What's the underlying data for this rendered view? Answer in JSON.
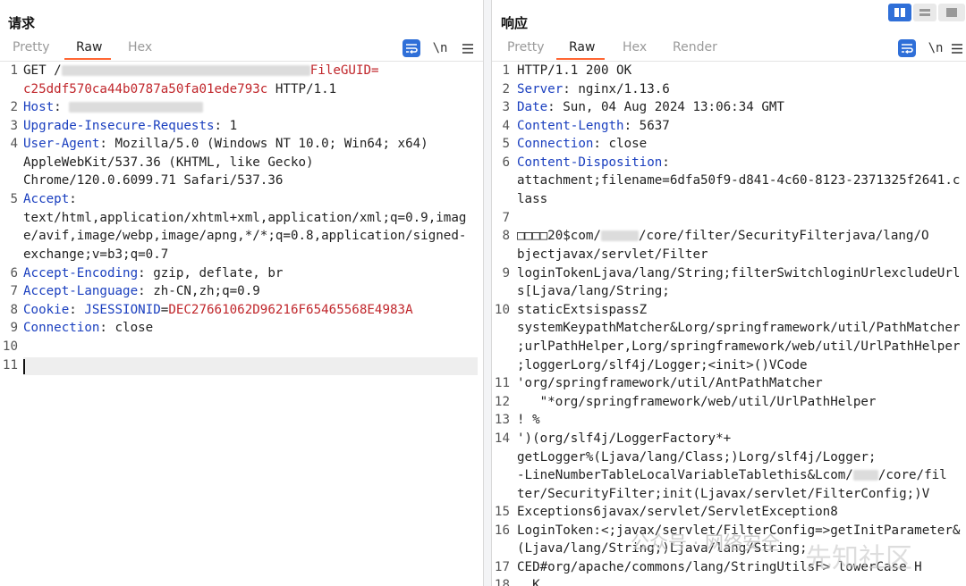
{
  "request": {
    "title": "请求",
    "tabs": [
      "Pretty",
      "Raw",
      "Hex"
    ],
    "active_tab": "Raw",
    "wrap_icon": "wrap-lines-icon",
    "newline_toggle": "\\n",
    "menu_icon": "hamburger-menu-icon",
    "lines": {
      "l1a": "GET /",
      "l1b": "FileGUID=",
      "l1c": "c25ddf570ca44b0787a50fa01ede793c",
      "l1d": " HTTP/1.1",
      "l2k": "Host",
      "l2s": ": ",
      "l3k": "Upgrade-Insecure-Requests",
      "l3v": ": 1",
      "l4k": "User-Agent",
      "l4v": ": Mozilla/5.0 (Windows NT 10.0; Win64; x64)",
      "l4c1": "AppleWebKit/537.36 (KHTML, like Gecko)",
      "l4c2": "Chrome/120.0.6099.71 Safari/537.36",
      "l5k": "Accept",
      "l5s": ":",
      "l5c1": "text/html,application/xhtml+xml,application/xml;q=0.9,imag",
      "l5c2": "e/avif,image/webp,image/apng,*/*;q=0.8,application/signed-",
      "l5c3": "exchange;v=b3;q=0.7",
      "l6k": "Accept-Encoding",
      "l6v": ": gzip, deflate, br",
      "l7k": "Accept-Language",
      "l7v": ": zh-CN,zh;q=0.9",
      "l8k": "Cookie",
      "l8s": ": ",
      "l8ck": "JSESSIONID",
      "l8eq": "=",
      "l8cv": "DEC27661062D96216F65465568E4983A",
      "l9k": "Connection",
      "l9v": ": close"
    },
    "line_numbers": [
      "1",
      "2",
      "3",
      "4",
      "5",
      "6",
      "7",
      "8",
      "9",
      "10",
      "11"
    ]
  },
  "response": {
    "title": "响应",
    "tabs": [
      "Pretty",
      "Raw",
      "Hex",
      "Render"
    ],
    "active_tab": "Raw",
    "wrap_icon": "wrap-lines-icon",
    "newline_toggle": "\\n",
    "menu_icon": "hamburger-menu-icon",
    "lines": {
      "l1": "HTTP/1.1 200 OK",
      "l2k": "Server",
      "l2v": ": nginx/1.13.6",
      "l3k": "Date",
      "l3v": ": Sun, 04 Aug 2024 13:06:34 GMT",
      "l4k": "Content-Length",
      "l4v": ": 5637",
      "l5k": "Connection",
      "l5v": ": close",
      "l6k": "Content-Disposition",
      "l6v": ":",
      "l6c1": "attachment;filename=6dfa50f9-d841-4c60-8123-2371325f2641.c",
      "l6c2": "lass",
      "l8a": "□□□□20$com/",
      "l8b": "/core/filter/SecurityFilterjava/lang/O",
      "l8c": "bjectjavax/servlet/Filter",
      "l9a": "loginTokenLjava/lang/String;filterSwitchloginUrlexcludeUrl",
      "l9b": "s[Ljava/lang/String;",
      "l10a": "staticExtsispassZ",
      "l10b": "systemKeypathMatcher&Lorg/springframework/util/PathMatcher",
      "l10c": ";urlPathHelper,Lorg/springframework/web/util/UrlPathHelper",
      "l10d": ";loggerLorg/slf4j/Logger;<init>()VCode",
      "l11": "'org/springframework/util/AntPathMatcher",
      "l12": "   \"*org/springframework/web/util/UrlPathHelper",
      "l13": "! %",
      "l14a": "')(org/slf4j/LoggerFactory*+",
      "l14b": "getLogger%(Ljava/lang/Class;)Lorg/slf4j/Logger;",
      "l14c": "-LineNumberTableLocalVariableTablethis&Lcom/",
      "l14d": "/core/fil",
      "l14e": "ter/SecurityFilter;init(Ljavax/servlet/FilterConfig;)V",
      "l15": "Exceptions6javax/servlet/ServletException8",
      "l16a": "LoginToken:<;javax/servlet/FilterConfig=>getInitParameter&",
      "l16b": "(Ljava/lang/String;)Ljava/lang/String;",
      "l17": "CED#org/apache/commons/lang/StringUtilsF> lowerCase H",
      "l18": "  K"
    },
    "line_numbers": [
      "1",
      "2",
      "3",
      "4",
      "5",
      "6",
      "7",
      "8",
      "9",
      "10",
      "11",
      "12",
      "13",
      "14",
      "15",
      "16",
      "17",
      "18"
    ],
    "watermark": "公众号 · 网络安全",
    "watermark2": "先知社区"
  },
  "colors": {
    "header_key": "#1a3fbf",
    "header_value": "#c0262b",
    "tab_underline": "#ff6633",
    "wrap_button": "#2f6fd8"
  }
}
